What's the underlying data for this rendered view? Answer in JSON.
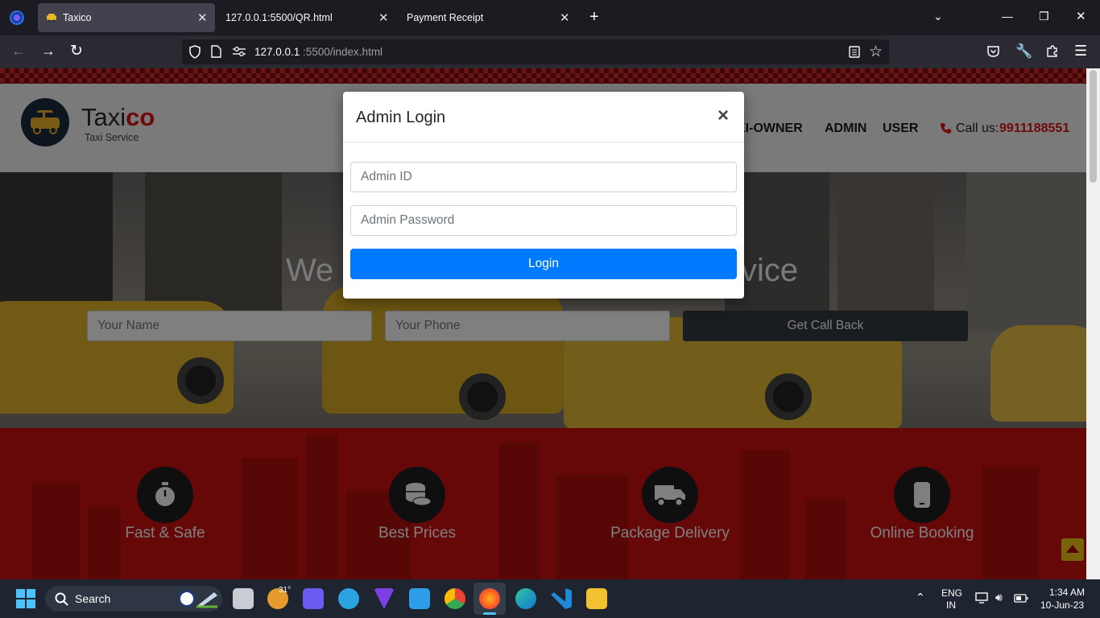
{
  "browser": {
    "tabs": [
      {
        "title": "Taxico",
        "active": true
      },
      {
        "title": "127.0.0.1:5500/QR.html",
        "active": false
      },
      {
        "title": "Payment Receipt",
        "active": false
      }
    ],
    "url_host": "127.0.0.1",
    "url_path": ":5500/index.html",
    "new_tab_symbol": "+"
  },
  "site": {
    "brand_main": "Taxi",
    "brand_accent": "co",
    "tagline": "Taxi Service",
    "nav": [
      "XI-OWNER",
      "ADMIN",
      "USER"
    ],
    "call_label": "Call us:",
    "phone": "9911188551",
    "hero_heading_left": "We",
    "hero_heading_right": "vice",
    "form": {
      "name_placeholder": "Your Name",
      "phone_placeholder": "Your Phone",
      "submit": "Get Call Back"
    },
    "features": [
      {
        "label": "Fast & Safe",
        "icon": "stopwatch-icon"
      },
      {
        "label": "Best Prices",
        "icon": "coins-icon"
      },
      {
        "label": "Package Delivery",
        "icon": "truck-icon"
      },
      {
        "label": "Online Booking",
        "icon": "mobile-icon"
      }
    ],
    "accent_color": "#cc1111"
  },
  "modal": {
    "title": "Admin Login",
    "close_symbol": "×",
    "id_placeholder": "Admin ID",
    "password_placeholder": "Admin Password",
    "button": "Login",
    "button_color": "#007bff"
  },
  "taskbar": {
    "search_label": "Search",
    "weather": "31°",
    "lang_line1": "ENG",
    "lang_line2": "IN",
    "time": "1:34 AM",
    "date": "10-Jun-23"
  }
}
